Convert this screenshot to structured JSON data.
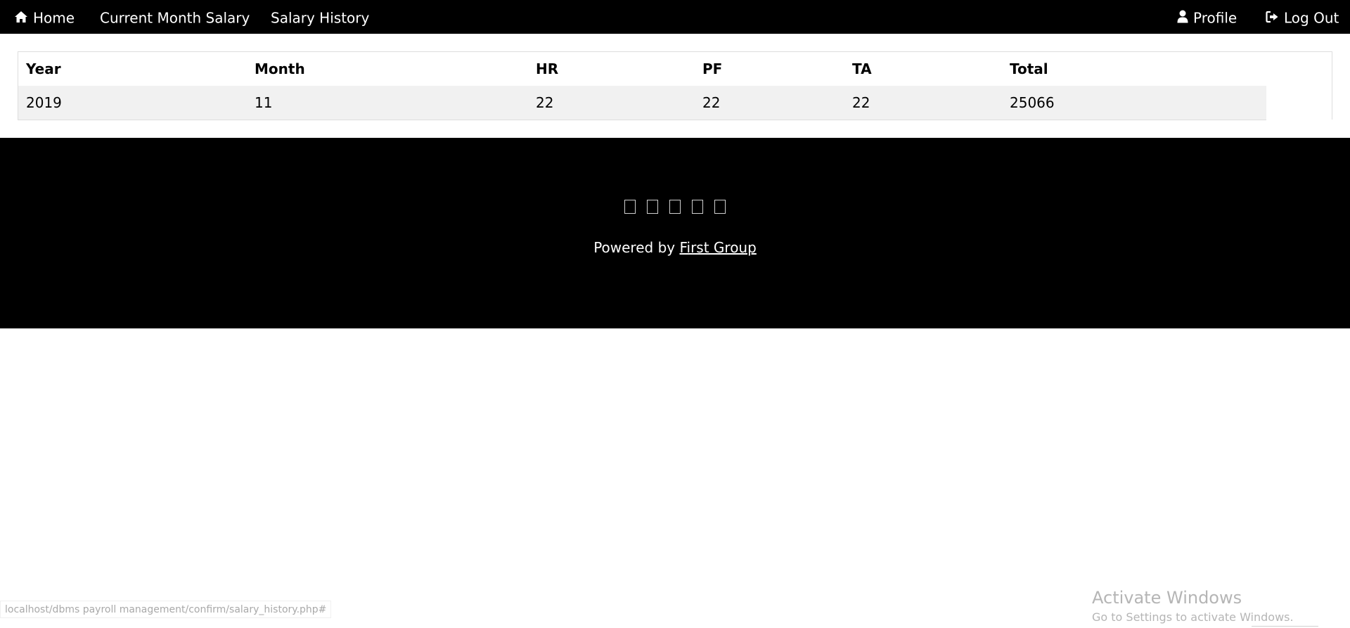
{
  "nav": {
    "home": {
      "label": "Home",
      "icon": "home-icon"
    },
    "current_month_salary": {
      "label": "Current Month Salary"
    },
    "salary_history": {
      "label": "Salary History"
    },
    "profile": {
      "label": "Profile",
      "icon": "user-icon"
    },
    "logout": {
      "label": "Log Out",
      "icon": "sign-out-icon"
    }
  },
  "table": {
    "headers": [
      "Year",
      "Month",
      "HR",
      "PF",
      "TA",
      "Total"
    ],
    "rows": [
      [
        "2019",
        "11",
        "22",
        "22",
        "22",
        "25066"
      ]
    ]
  },
  "footer": {
    "social_icons": [
      "social-icon-1",
      "social-icon-2",
      "social-icon-3",
      "social-icon-4",
      "social-icon-5"
    ],
    "powered_by_prefix": "Powered by",
    "powered_by_link": "First Group"
  },
  "status_bar": {
    "url": "localhost/dbms payroll management/confirm/salary_history.php#"
  },
  "watermark": {
    "title": "Activate Windows",
    "subtitle": "Go to Settings to activate Windows."
  },
  "colors": {
    "nav_bg": "#000000",
    "footer_bg": "#000000",
    "row_alt": "#f1f1f1"
  }
}
